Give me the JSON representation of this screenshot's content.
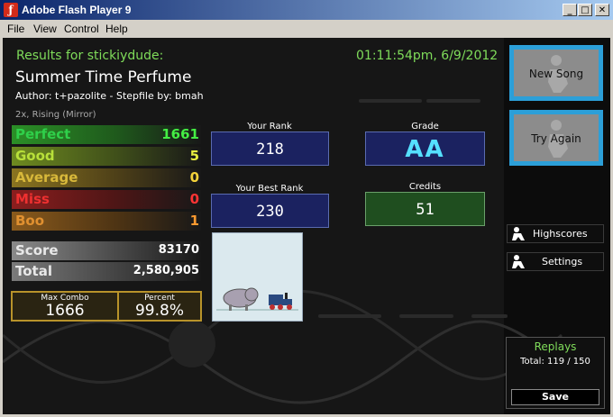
{
  "window": {
    "title": "Adobe Flash Player 9",
    "menu": [
      "File",
      "View",
      "Control",
      "Help"
    ],
    "menu_underline": [
      "F",
      "V",
      "C",
      "H"
    ]
  },
  "results": {
    "header": "Results for stickiydude:",
    "datetime": "01:11:54pm, 6/9/2012",
    "song": "Summer Time Perfume",
    "author_line": "Author: t+pazolite   -   Stepfile by: bmah",
    "mods": "2x, Rising (Mirror)"
  },
  "judgements": [
    {
      "label": "Perfect",
      "value": "1661",
      "label_color": "#2fb52a",
      "value_color": "#44ee44"
    },
    {
      "label": "Good",
      "value": "5",
      "label_color": "#b8d23a",
      "value_color": "#e8f040"
    },
    {
      "label": "Average",
      "value": "0",
      "label_color": "#d0b038",
      "value_color": "#f4d23a"
    },
    {
      "label": "Miss",
      "value": "0",
      "label_color": "#d63030",
      "value_color": "#ff3434"
    },
    {
      "label": "Boo",
      "value": "1",
      "label_color": "#d58a2a",
      "value_color": "#ff9a30"
    }
  ],
  "score": {
    "label": "Score",
    "value": "83170"
  },
  "total": {
    "label": "Total",
    "value": "2,580,905"
  },
  "max_combo": {
    "label": "Max Combo",
    "value": "1666"
  },
  "percent": {
    "label": "Percent",
    "value": "99.8%"
  },
  "your_rank": {
    "label": "Your Rank",
    "value": "218"
  },
  "best_rank": {
    "label": "Your Best Rank",
    "value": "230"
  },
  "grade": {
    "label": "Grade",
    "value": "AA"
  },
  "credits": {
    "label": "Credits",
    "value": "51"
  },
  "buttons": {
    "new_song": "New Song",
    "try_again": "Try Again",
    "highscores": "Highscores",
    "settings": "Settings",
    "save": "Save"
  },
  "replays": {
    "title": "Replays",
    "total": "Total: 119 / 150"
  },
  "colors": {
    "accent_green": "#7fdc5a",
    "button_blue": "#2c9fd8",
    "panel_navy": "#1b2260",
    "grade_cyan": "#55e0ff"
  }
}
